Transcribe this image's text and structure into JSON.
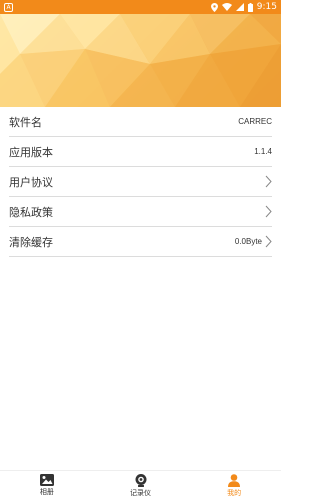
{
  "status_bar": {
    "notification_icon": "notification-icon",
    "time": "9:15",
    "bg_color": "#f28a1a"
  },
  "settings": {
    "items": [
      {
        "label": "软件名",
        "value": "CARREC",
        "chevron": false
      },
      {
        "label": "应用版本",
        "value": "1.1.4",
        "chevron": false
      },
      {
        "label": "用户协议",
        "value": "",
        "chevron": true
      },
      {
        "label": "隐私政策",
        "value": "",
        "chevron": true
      },
      {
        "label": "清除缓存",
        "value": "0.0Byte",
        "chevron": true
      }
    ]
  },
  "bottom_nav": {
    "items": [
      {
        "label": "相册",
        "icon": "photo-album-icon",
        "active": false
      },
      {
        "label": "记录仪",
        "icon": "camera-recorder-icon",
        "active": false
      },
      {
        "label": "我的",
        "icon": "user-profile-icon",
        "active": true
      }
    ],
    "active_color": "#f28a1a"
  }
}
